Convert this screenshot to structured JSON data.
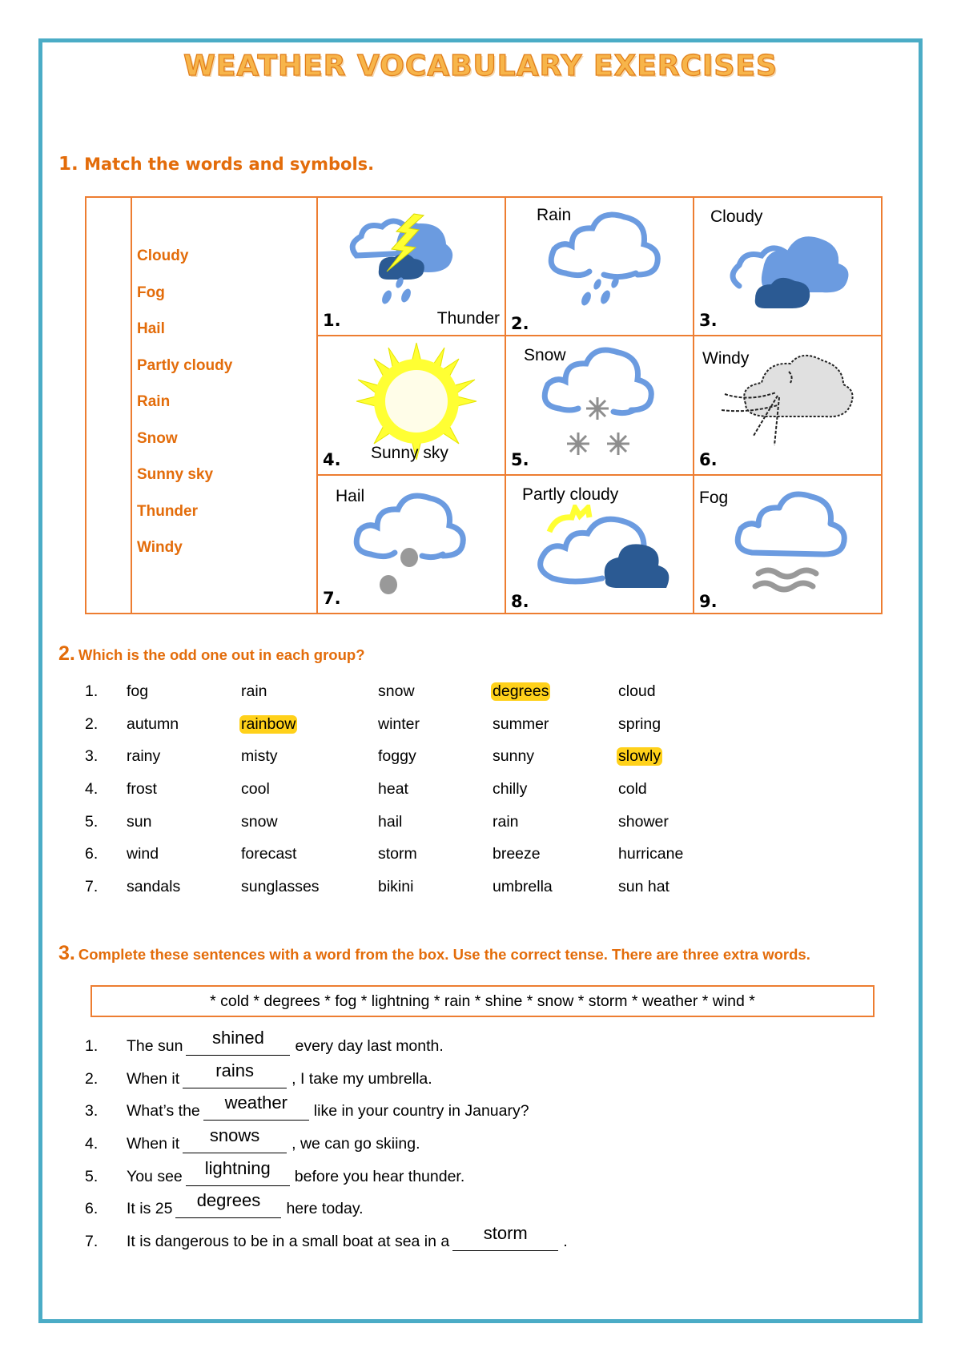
{
  "page": {
    "title": "WEATHER VOCABULARY EXERCISES",
    "border_color": "#4bacc6",
    "accent_color": "#e36c0a",
    "highlight_color": "#ffd11a"
  },
  "section1": {
    "number": "1.",
    "heading": "Match the words and symbols.",
    "words": [
      "Cloudy",
      "Fog",
      "Hail",
      "Partly cloudy",
      "Rain",
      "Snow",
      "Sunny sky",
      "Thunder",
      "Windy"
    ],
    "symbols": [
      {
        "number": "1.",
        "caption": "Thunder",
        "icon": "thunderstorm-icon"
      },
      {
        "number": "2.",
        "caption": "Rain",
        "icon": "rain-cloud-icon"
      },
      {
        "number": "3.",
        "caption": "Cloudy",
        "icon": "cloudy-icon"
      },
      {
        "number": "4.",
        "caption": "Sunny sky",
        "icon": "sun-icon"
      },
      {
        "number": "5.",
        "caption": "Snow",
        "icon": "snow-cloud-icon"
      },
      {
        "number": "6.",
        "caption": "Windy",
        "icon": "windy-cloud-icon"
      },
      {
        "number": "7.",
        "caption": "Hail",
        "icon": "hail-cloud-icon"
      },
      {
        "number": "8.",
        "caption": "Partly cloudy",
        "icon": "partly-cloudy-icon"
      },
      {
        "number": "9.",
        "caption": "Fog",
        "icon": "fog-cloud-icon"
      }
    ]
  },
  "section2": {
    "number": "2.",
    "heading": "Which is the odd one out in each group?",
    "groups": [
      {
        "number": "1.",
        "words": [
          "fog",
          "rain",
          "snow",
          "degrees",
          "cloud"
        ],
        "answer_index": 3
      },
      {
        "number": "2.",
        "words": [
          "autumn",
          "rainbow",
          "winter",
          "summer",
          "spring"
        ],
        "answer_index": 1
      },
      {
        "number": "3.",
        "words": [
          "rainy",
          "misty",
          "foggy",
          "sunny",
          "slowly"
        ],
        "answer_index": 4
      },
      {
        "number": "4.",
        "words": [
          "frost",
          "cool",
          "heat",
          "chilly",
          "cold"
        ],
        "answer_index": -1
      },
      {
        "number": "5.",
        "words": [
          "sun",
          "snow",
          "hail",
          "rain",
          "shower"
        ],
        "answer_index": -1
      },
      {
        "number": "6.",
        "words": [
          "wind",
          "forecast",
          "storm",
          "breeze",
          "hurricane"
        ],
        "answer_index": -1
      },
      {
        "number": "7.",
        "words": [
          "sandals",
          "sunglasses",
          "bikini",
          "umbrella",
          "sun hat"
        ],
        "answer_index": -1
      }
    ]
  },
  "section3": {
    "number": "3.",
    "heading": "Complete these sentences with a word from the box. Use the correct tense. There are three extra words.",
    "word_box": "* cold * degrees * fog * lightning * rain * shine * snow * storm * weather * wind *",
    "sentences": [
      {
        "number": "1.",
        "before": "The sun",
        "answer": "shined",
        "after": "every day last month."
      },
      {
        "number": "2.",
        "before": "When it",
        "answer": "rains",
        "after": ", I take my umbrella."
      },
      {
        "number": "3.",
        "before": "What’s the",
        "answer": "weather",
        "after": "like in your country in January?"
      },
      {
        "number": "4.",
        "before": "When it",
        "answer": "snows",
        "after": ", we can go skiing."
      },
      {
        "number": "5.",
        "before": "You see",
        "answer": "lightning",
        "after": "before you hear thunder."
      },
      {
        "number": "6.",
        "before": "It is 25",
        "answer": "degrees",
        "after": "here today."
      },
      {
        "number": "7.",
        "before": "It is dangerous to be in a small boat at sea in a",
        "answer": "storm",
        "after": "."
      }
    ]
  }
}
